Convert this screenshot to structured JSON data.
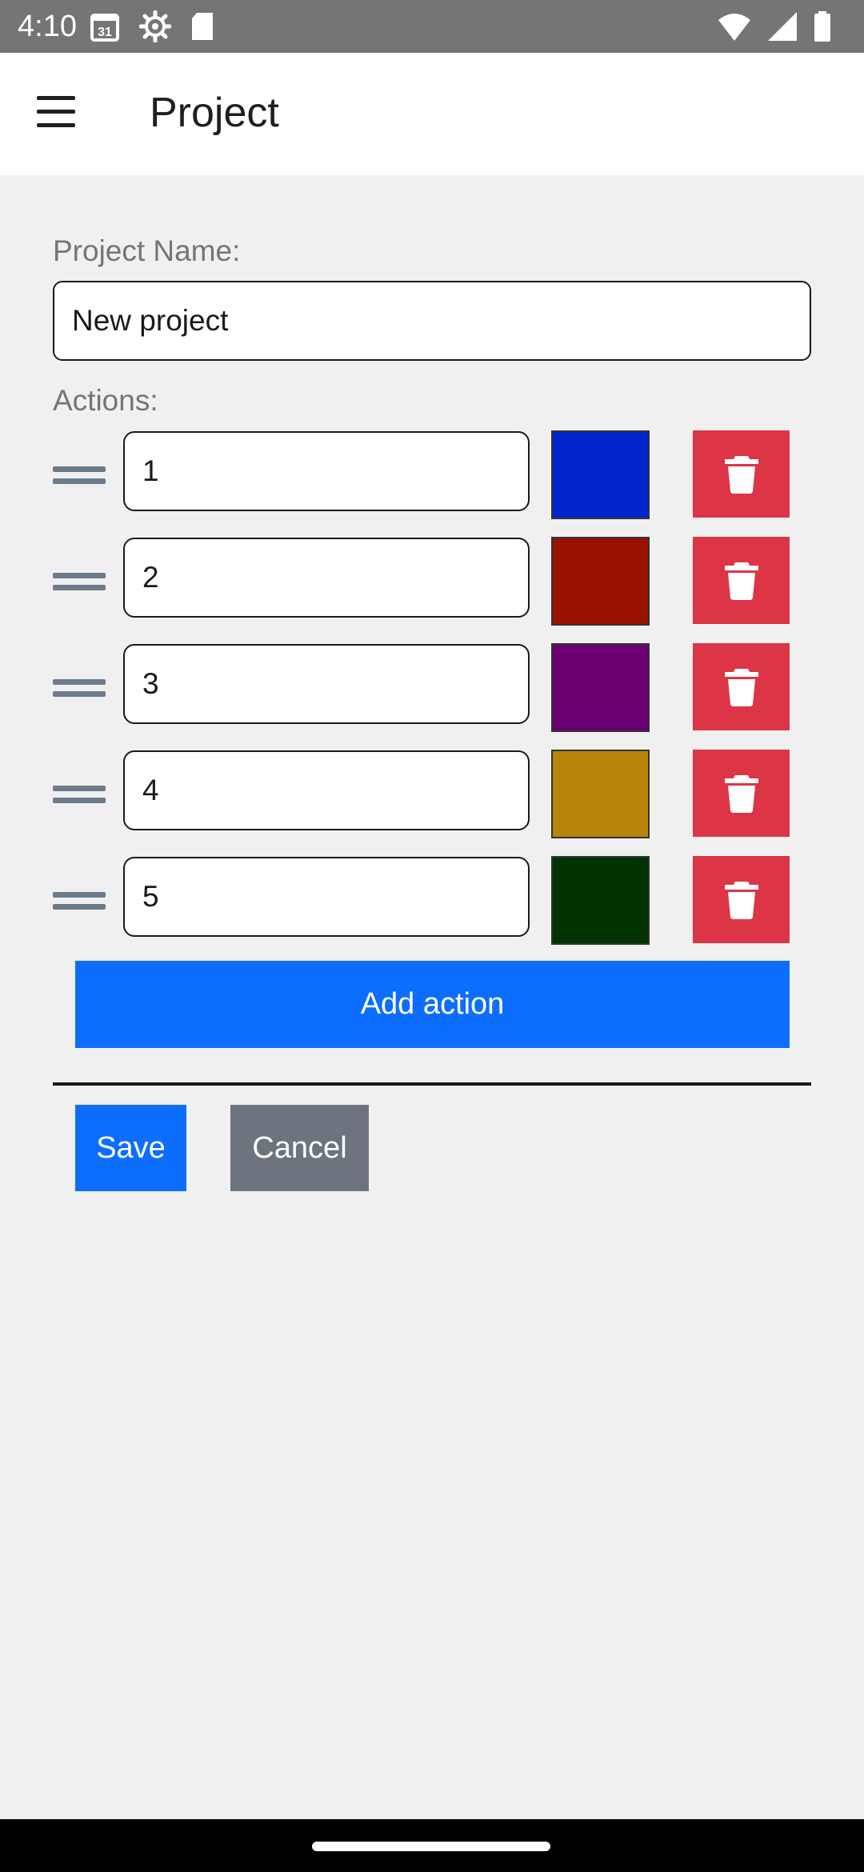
{
  "status_bar": {
    "time": "4:10",
    "left_icons": [
      "calendar-icon",
      "settings-icon",
      "sd-card-icon"
    ],
    "right_icons": [
      "wifi-icon",
      "signal-icon",
      "battery-icon"
    ],
    "calendar_day": "31"
  },
  "app_bar": {
    "menu_icon": "menu-icon",
    "title": "Project"
  },
  "form": {
    "project_name_label": "Project Name:",
    "project_name_value": "New project",
    "actions_label": "Actions:",
    "actions": [
      {
        "value": "1",
        "color": "#0026cc"
      },
      {
        "value": "2",
        "color": "#991100"
      },
      {
        "value": "3",
        "color": "#6b0073"
      },
      {
        "value": "4",
        "color": "#b8860b"
      },
      {
        "value": "5",
        "color": "#003300"
      }
    ],
    "delete_icon": "trash-icon",
    "drag_icon": "drag-handle-icon",
    "add_action_label": "Add action",
    "save_label": "Save",
    "cancel_label": "Cancel"
  },
  "colors": {
    "primary": "#0d6efd",
    "danger": "#dc3545",
    "secondary": "#6c757d",
    "status_bar": "#757575",
    "background": "#f0f0f0"
  }
}
